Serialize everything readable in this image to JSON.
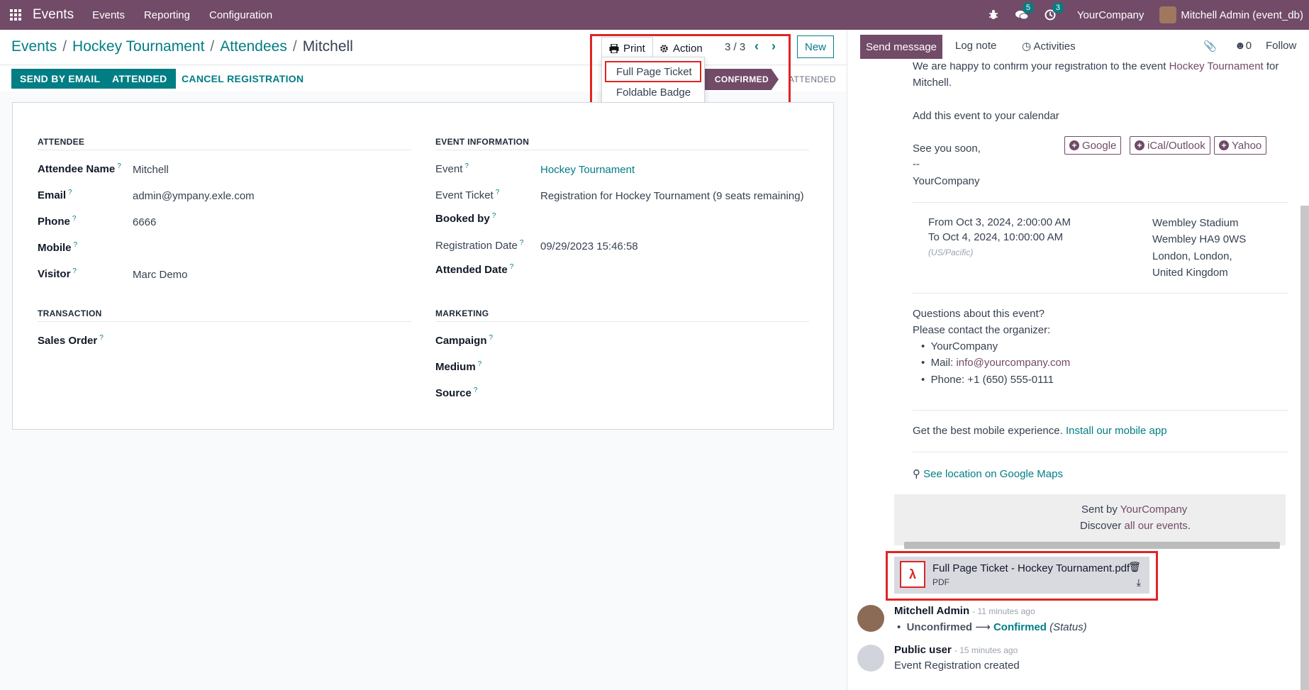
{
  "topbar": {
    "app_name": "Events",
    "menus": [
      "Events",
      "Reporting",
      "Configuration"
    ],
    "messages_count": "5",
    "activities_count": "3",
    "company": "YourCompany",
    "user": "Mitchell Admin (event_db)"
  },
  "breadcrumb": {
    "items": [
      "Events",
      "Hockey Tournament",
      "Attendees"
    ],
    "current": "Mitchell"
  },
  "toolbar": {
    "print_label": "Print",
    "action_label": "Action",
    "pager": "3 / 3",
    "new_label": "New"
  },
  "print_menu": {
    "items": [
      "Full Page Ticket",
      "Foldable Badge"
    ]
  },
  "status_buttons": {
    "send_email": "SEND BY EMAIL",
    "attended": "ATTENDED",
    "cancel": "CANCEL REGISTRATION"
  },
  "stages": {
    "confirmed": "CONFIRMED",
    "attended": "ATTENDED"
  },
  "form": {
    "attendee_title": "ATTENDEE",
    "event_info_title": "EVENT INFORMATION",
    "transaction_title": "TRANSACTION",
    "marketing_title": "MARKETING",
    "attendee_name_label": "Attendee Name",
    "attendee_name": "Mitchell",
    "email_label": "Email",
    "email": "admin@ympany.exle.com",
    "phone_label": "Phone",
    "phone": "6666",
    "mobile_label": "Mobile",
    "visitor_label": "Visitor",
    "visitor": "Marc Demo",
    "sales_order_label": "Sales Order",
    "event_label": "Event",
    "event": "Hockey Tournament",
    "ticket_label": "Event Ticket",
    "ticket": "Registration for Hockey Tournament (9 seats remaining)",
    "booked_by_label": "Booked by",
    "reg_date_label": "Registration Date",
    "reg_date": "09/29/2023 15:46:58",
    "attended_date_label": "Attended Date",
    "campaign_label": "Campaign",
    "medium_label": "Medium",
    "source_label": "Source",
    "help_mark": "?"
  },
  "chatter": {
    "send_message": "Send message",
    "log_note": "Log note",
    "activities": "Activities",
    "followers_count": "0",
    "follow": "Follow",
    "mail": {
      "line1a": "We are happy to confirm your registration to the event",
      "line1_event": "Hockey Tournament",
      "line1b": "for",
      "line2": "Mitchell.",
      "calendar_label": "Add this event to your calendar",
      "cal_google": "Google",
      "cal_ical": "iCal/Outlook",
      "cal_yahoo": "Yahoo",
      "see_you": "See you soon,",
      "dashes": "--",
      "signature": "YourCompany",
      "from": "From Oct 3, 2024, 2:00:00 AM",
      "to": "To Oct 4, 2024, 10:00:00 AM",
      "tz": "(US/Pacific)",
      "venue1": "Wembley Stadium",
      "venue2": "Wembley HA9 0WS",
      "venue3": "London, London,",
      "venue4": "United Kingdom",
      "questions": "Questions about this event?",
      "contact": "Please contact the organizer:",
      "org_name": "YourCompany",
      "mail_label": "Mail:",
      "mail_addr": "info@yourcompany.com",
      "phone": "Phone: +1 (650) 555-0111",
      "mobile_text": "Get the best mobile experience.",
      "mobile_link": "Install our mobile app",
      "maps_link": "See location on Google Maps",
      "sent_by": "Sent by",
      "sent_by_company": "YourCompany",
      "discover": "Discover",
      "discover_link": "all our events",
      "discover_end": "."
    },
    "attachment": {
      "name": "Full Page Ticket - Hockey Tournament.pdf",
      "type": "PDF"
    },
    "messages": [
      {
        "author": "Mitchell Admin",
        "time": "- 11 minutes ago",
        "old": "Unconfirmed",
        "new": "Confirmed",
        "field": "(Status)"
      },
      {
        "author": "Public user",
        "time": "- 15 minutes ago",
        "body": "Event Registration created"
      }
    ]
  }
}
